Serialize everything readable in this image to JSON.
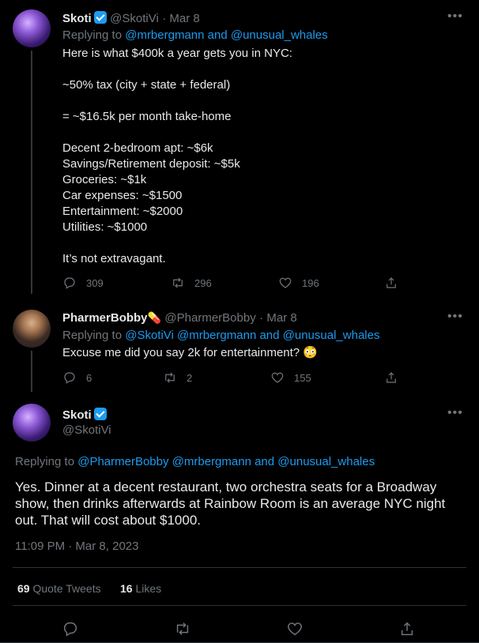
{
  "tweet1": {
    "name": "Skoti",
    "handle": "@SkotiVi",
    "date": "· Mar 8",
    "replying_prefix": "Replying to ",
    "replying_mentions": "@mrbergmann and @unusual_whales",
    "body": "Here is what $400k a year gets you in NYC:\n\n~50% tax (city + state + federal)\n\n= ~$16.5k per month take-home\n\nDecent 2-bedroom apt: ~$6k\nSavings/Retirement deposit: ~$5k\nGroceries: ~$1k\nCar expenses: ~$1500\nEntertainment: ~$2000\nUtilities: ~$1000\n\nIt’s not extravagant.",
    "replies": "309",
    "retweets": "296",
    "likes": "196"
  },
  "tweet2": {
    "name": "PharmerBobby",
    "name_emoji": "💊",
    "handle": "@PharmerBobby",
    "date": "· Mar 8",
    "replying_prefix": "Replying to ",
    "replying_mentions": "@SkotiVi @mrbergmann and @unusual_whales",
    "body": "Excuse me did you say 2k for entertainment? 😳",
    "replies": "6",
    "retweets": "2",
    "likes": "155"
  },
  "main_tweet": {
    "name": "Skoti",
    "handle": "@SkotiVi",
    "replying_prefix": "Replying to ",
    "replying_mentions": "@PharmerBobby @mrbergmann and @unusual_whales",
    "body": "Yes. Dinner at a decent restaurant, two orchestra seats for a Broadway show, then drinks afterwards at Rainbow Room is an average NYC night out. That will cost about $1000.",
    "timestamp": "11:09 PM · Mar 8, 2023",
    "quote_tweets_count": "69",
    "quote_tweets_label": "Quote Tweets",
    "likes_count": "16",
    "likes_label": "Likes"
  },
  "icons": {
    "reply": "reply-icon",
    "retweet": "retweet-icon",
    "like": "heart-icon",
    "share": "share-icon",
    "more": "more-icon",
    "verified": "verified-badge-icon"
  },
  "colors": {
    "background": "#000000",
    "text": "#e7e9ea",
    "muted": "#71767b",
    "link": "#1d9bf0",
    "divider": "#2f3336"
  }
}
